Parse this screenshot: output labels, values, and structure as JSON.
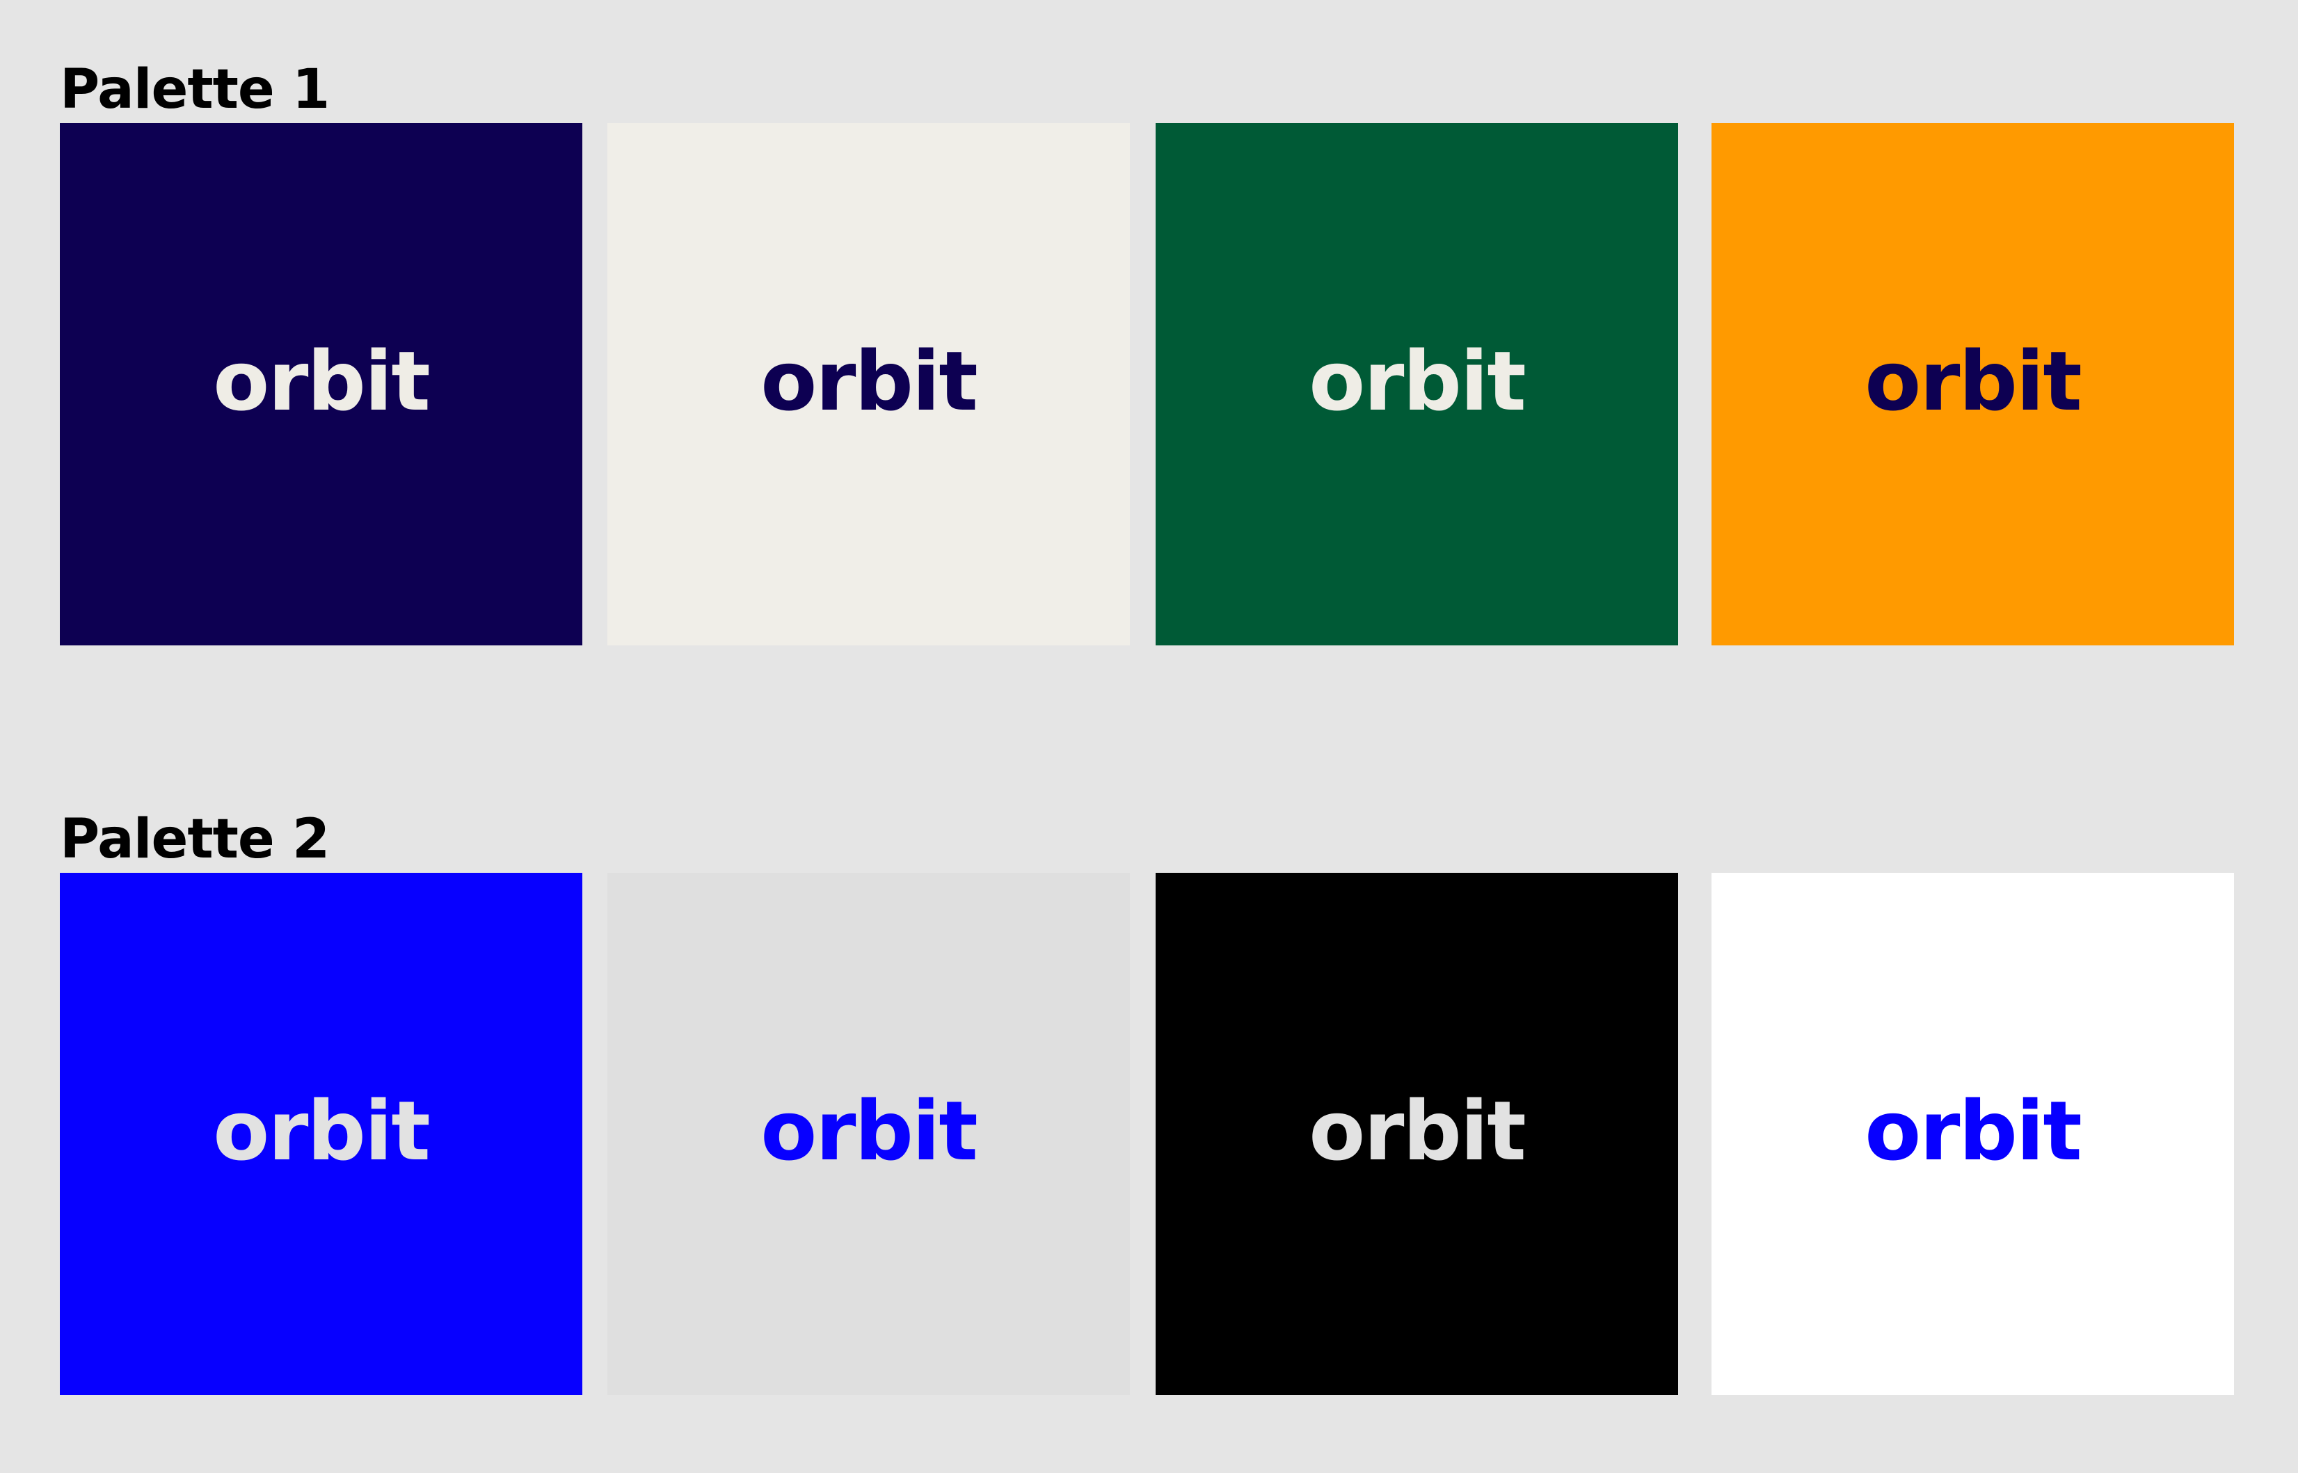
{
  "palettes": [
    {
      "title": "Palette 1",
      "swatches": [
        {
          "label": "orbit",
          "background": "#0d0052",
          "text_color": "#efede6"
        },
        {
          "label": "orbit",
          "background": "#f0eee8",
          "text_color": "#0d0052"
        },
        {
          "label": "orbit",
          "background": "#005a36",
          "text_color": "#efede6"
        },
        {
          "label": "orbit",
          "background": "#ff9a00",
          "text_color": "#0d0052"
        }
      ]
    },
    {
      "title": "Palette 2",
      "swatches": [
        {
          "label": "orbit",
          "background": "#0700ff",
          "text_color": "#e2e2e2"
        },
        {
          "label": "orbit",
          "background": "#dfdfdf",
          "text_color": "#0700ff"
        },
        {
          "label": "orbit",
          "background": "#000000",
          "text_color": "#e2e2e2"
        },
        {
          "label": "orbit",
          "background": "#ffffff",
          "text_color": "#0700ff"
        }
      ]
    }
  ]
}
